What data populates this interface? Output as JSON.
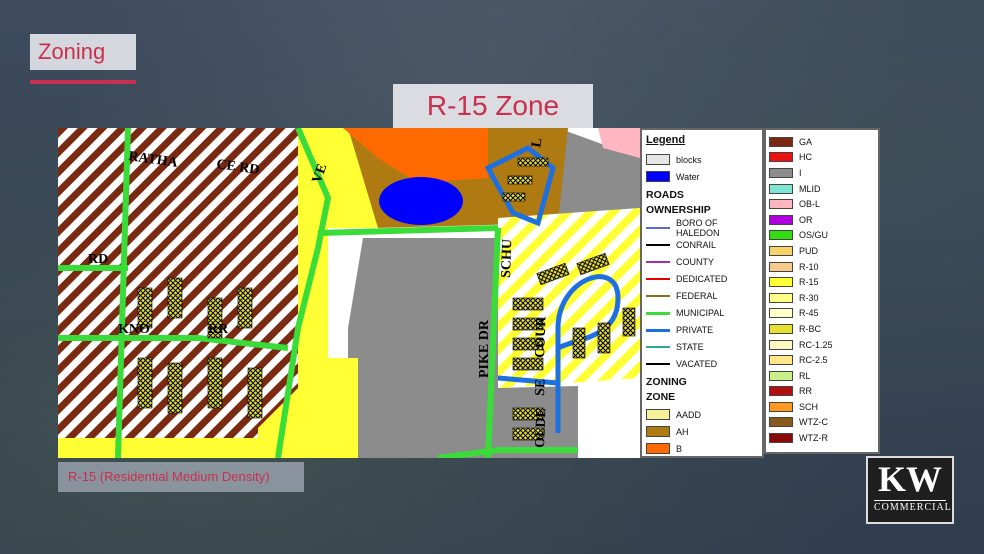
{
  "slide": {
    "title": "Zoning",
    "zone_title": "R-15 Zone",
    "caption": "R-15 (Residential Medium Density)"
  },
  "map": {
    "street_labels": [
      "RATHA",
      "CE RD",
      "VE",
      "RD",
      "KNO",
      "RR",
      "PIKE DR",
      "SCHU",
      "L",
      "OLDE",
      "SE",
      "COUR"
    ]
  },
  "legend": {
    "title": "Legend",
    "base_items": [
      {
        "label": "blocks",
        "color": "#e6e6e6"
      },
      {
        "label": "Water",
        "color": "#0000ff"
      }
    ],
    "roads_heading": "ROADS",
    "ownership_heading": "OWNERSHIP",
    "roads": [
      {
        "label": "BORO OF HALEDON",
        "color": "#5a6bd0"
      },
      {
        "label": "CONRAIL",
        "color": "#000000"
      },
      {
        "label": "COUNTY",
        "color": "#9b30b0"
      },
      {
        "label": "DEDICATED",
        "color": "#e00000"
      },
      {
        "label": "FEDERAL",
        "color": "#8a6d1a"
      },
      {
        "label": "MUNICIPAL",
        "color": "#3adc3a"
      },
      {
        "label": "PRIVATE",
        "color": "#1e6fe0"
      },
      {
        "label": "STATE",
        "color": "#2aa79b"
      },
      {
        "label": "VACATED",
        "color": "#000000"
      }
    ],
    "zoning_heading": "ZONING",
    "zone_heading": "ZONE",
    "zones_left": [
      {
        "label": "AADD",
        "color": "#f7f09a"
      },
      {
        "label": "AH",
        "color": "#b07a12"
      },
      {
        "label": "B",
        "color": "#ff6a00"
      }
    ],
    "zones_right": [
      {
        "label": "GA",
        "color": "#7a2a10"
      },
      {
        "label": "HC",
        "color": "#ee1111"
      },
      {
        "label": "I",
        "color": "#8c8c8c"
      },
      {
        "label": "MLID",
        "color": "#7fe6d4"
      },
      {
        "label": "OB-L",
        "color": "#ffb6c1"
      },
      {
        "label": "OR",
        "color": "#b000e0"
      },
      {
        "label": "OS/GU",
        "color": "#33dd11"
      },
      {
        "label": "PUD",
        "color": "#f5d26a"
      },
      {
        "label": "R-10",
        "color": "#f7c98a"
      },
      {
        "label": "R-15",
        "color": "#ffff33"
      },
      {
        "label": "R-30",
        "color": "#ffff88"
      },
      {
        "label": "R-45",
        "color": "#ffffc8"
      },
      {
        "label": "R-BC",
        "color": "#e8e030"
      },
      {
        "label": "RC-1.25",
        "color": "#fff7c0"
      },
      {
        "label": "RC-2.5",
        "color": "#fde68a"
      },
      {
        "label": "RL",
        "color": "#c8f08a"
      },
      {
        "label": "RR",
        "color": "#b01010"
      },
      {
        "label": "SCH",
        "color": "#ff9922"
      },
      {
        "label": "WTZ-C",
        "color": "#8a5a1a"
      },
      {
        "label": "WTZ-R",
        "color": "#8a0a0a"
      }
    ]
  },
  "logo": {
    "mark": "KW",
    "sub": "COMMERCIAL"
  }
}
